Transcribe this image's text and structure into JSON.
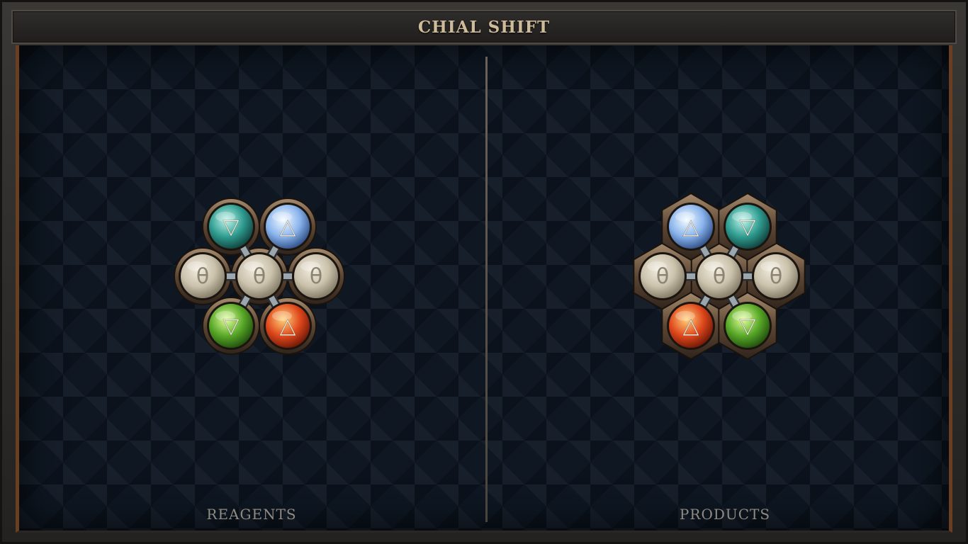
{
  "title": "CHIAL SHIFT",
  "panels": [
    {
      "label": "REAGENTS",
      "frame": "round",
      "atoms": {
        "top_left": "water",
        "top_right": "air",
        "left": "salt",
        "center": "salt",
        "right": "salt",
        "bottom_left": "earth",
        "bottom_right": "fire"
      }
    },
    {
      "label": "PRODUCTS",
      "frame": "hex",
      "atoms": {
        "top_left": "air",
        "top_right": "water",
        "left": "salt",
        "center": "salt",
        "right": "salt",
        "bottom_left": "fire",
        "bottom_right": "earth"
      }
    }
  ],
  "elements": {
    "water": {
      "symbol": "▽",
      "colors": [
        "#bff5ec",
        "#2f9c90",
        "#0f3e3a"
      ]
    },
    "air": {
      "symbol": "△",
      "colors": [
        "#f4fbff",
        "#8ab4ec",
        "#2b4a82"
      ]
    },
    "salt": {
      "symbol": "θ",
      "colors": [
        "#f1ecdf",
        "#cbc2ac",
        "#7e7562"
      ]
    },
    "earth": {
      "symbol": "▽",
      "colors": [
        "#e2ff9c",
        "#58a828",
        "#1e4a0c"
      ]
    },
    "fire": {
      "symbol": "△",
      "colors": [
        "#ffd27a",
        "#e0481c",
        "#6a1606"
      ]
    }
  },
  "palette": {
    "accent": "#cdbb9a",
    "board": "#0e1722",
    "frame_wood": "#6a3e20",
    "bond_steel": "#9ba6ad"
  }
}
